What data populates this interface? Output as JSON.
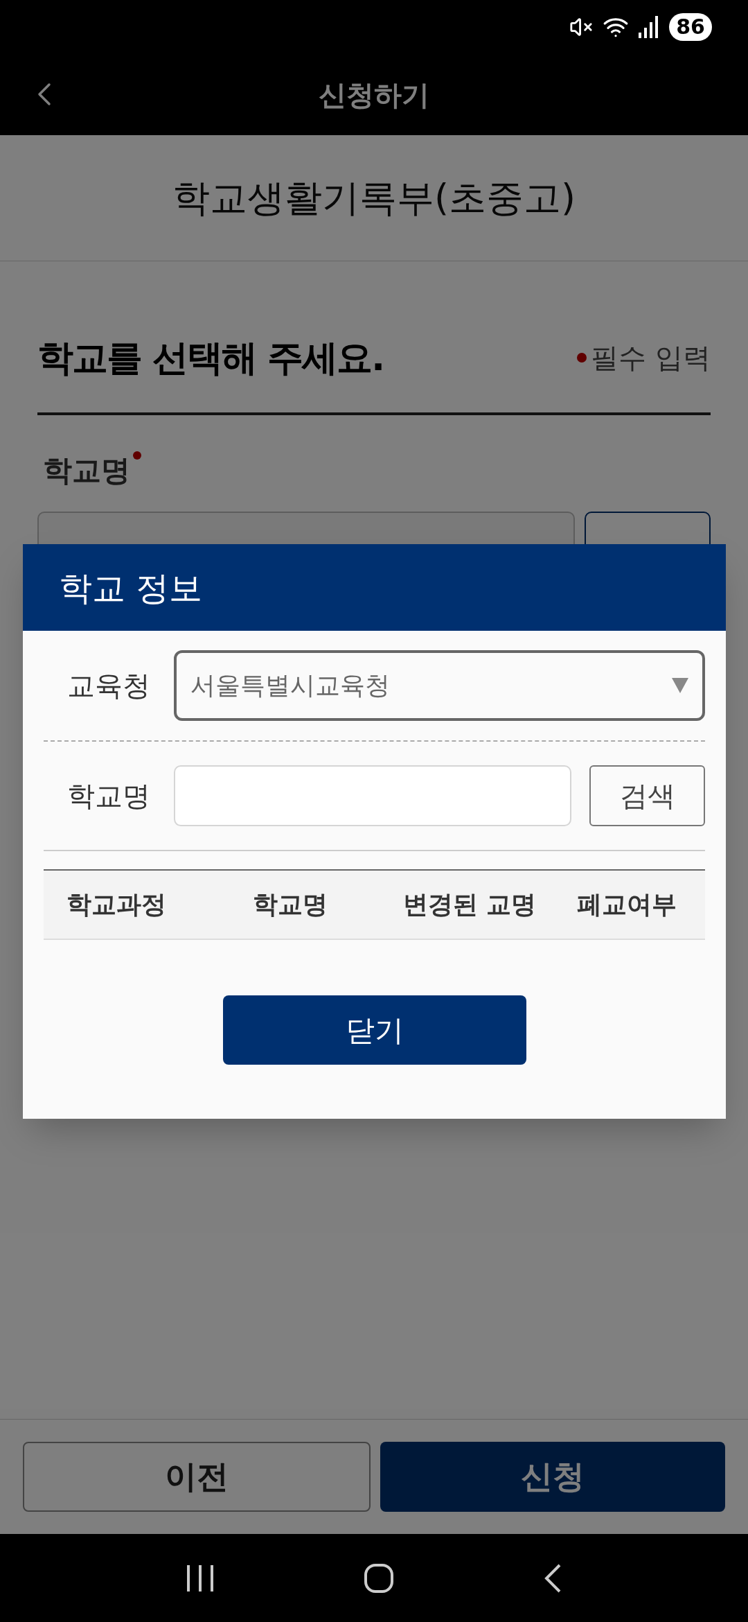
{
  "status_bar": {
    "battery": "86"
  },
  "header": {
    "title": "신청하기"
  },
  "page": {
    "doc_title": "학교생활기록부(초중고)",
    "heading": "학교를 선택해 주세요.",
    "required_note": "필수 입력",
    "field_label": "학교명"
  },
  "dialog": {
    "title": "학교 정보",
    "office_label": "교육청",
    "office_value": "서울특별시교육청",
    "name_label": "학교명",
    "search_button": "검색",
    "columns": [
      "학교과정",
      "학교명",
      "변경된 교명",
      "폐교여부"
    ],
    "close_button": "닫기"
  },
  "footer": {
    "prev_button": "이전",
    "submit_button": "신청"
  }
}
